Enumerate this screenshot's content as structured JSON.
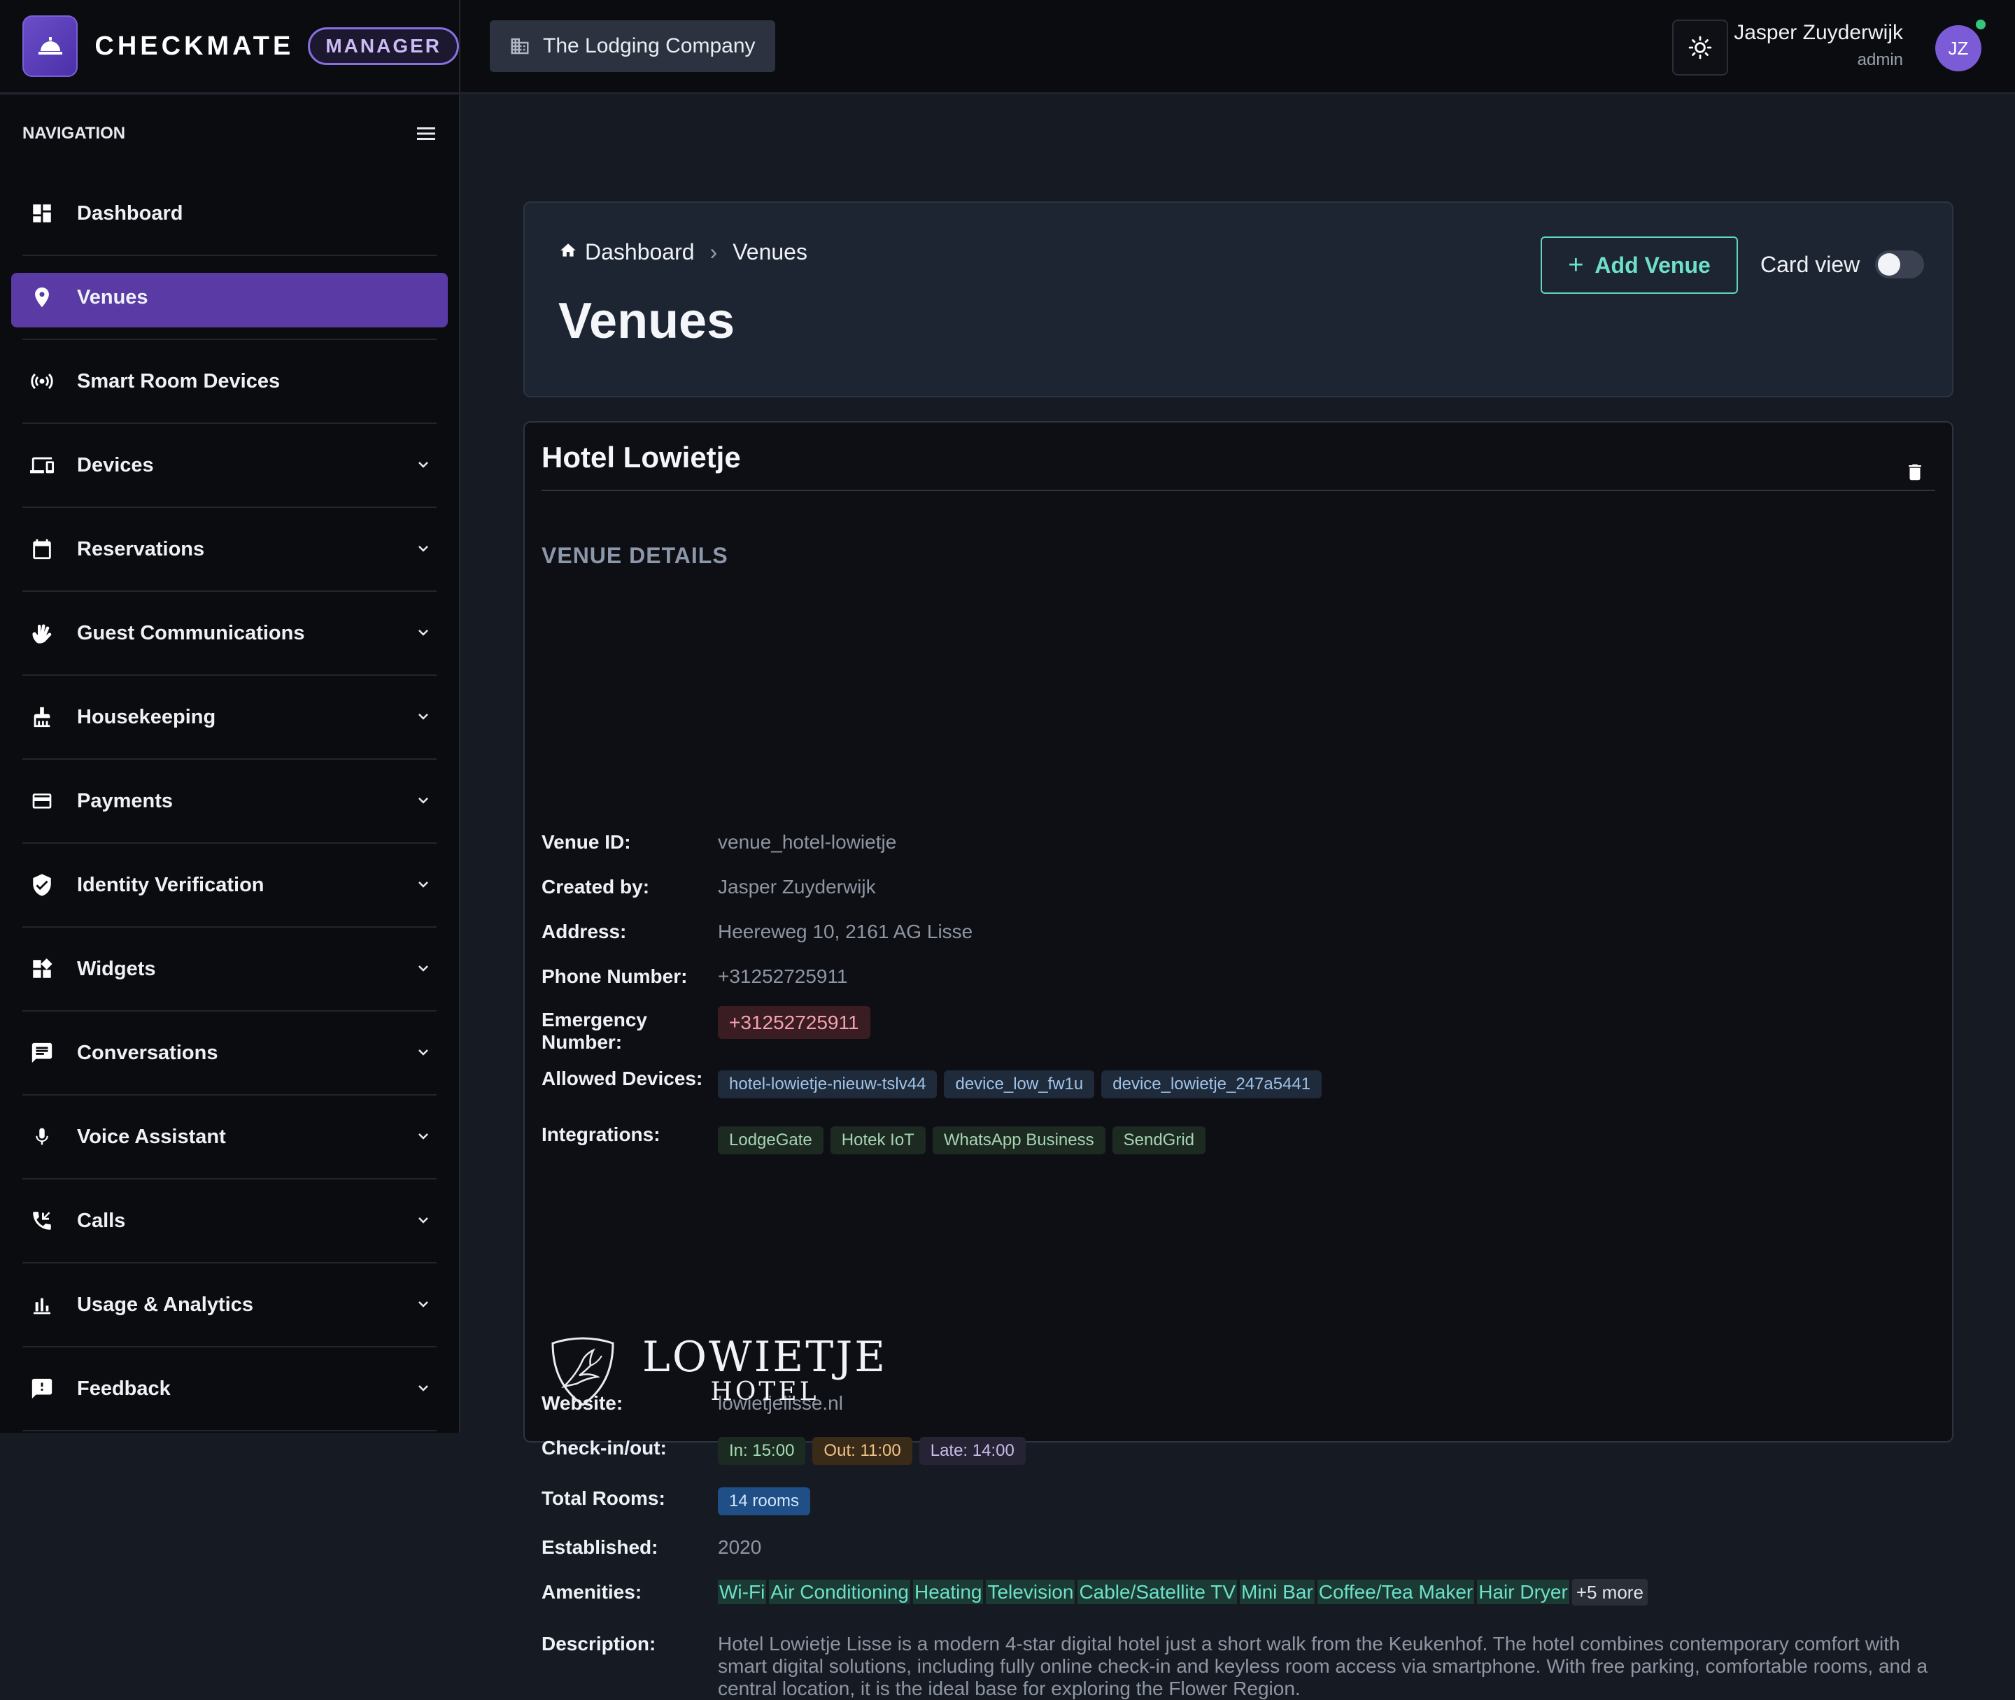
{
  "brand": {
    "name": "CHECKMATE",
    "badge": "MANAGER"
  },
  "company": {
    "name": "The Lodging Company"
  },
  "user": {
    "name": "Jasper Zuyderwijk",
    "role": "admin",
    "initials": "JZ"
  },
  "nav": {
    "title": "NAVIGATION",
    "items": [
      {
        "label": "Dashboard",
        "icon": "dashboard-icon"
      },
      {
        "label": "Venues",
        "icon": "location-pin-icon",
        "active": true
      },
      {
        "label": "Smart Room Devices",
        "icon": "broadcast-icon"
      },
      {
        "label": "Devices",
        "icon": "devices-icon"
      },
      {
        "label": "Reservations",
        "icon": "calendar-icon"
      },
      {
        "label": "Guest Communications",
        "icon": "waving-hand-icon"
      },
      {
        "label": "Housekeeping",
        "icon": "cleaning-icon"
      },
      {
        "label": "Payments",
        "icon": "credit-card-icon"
      },
      {
        "label": "Identity Verification",
        "icon": "verified-shield-icon"
      },
      {
        "label": "Widgets",
        "icon": "widgets-icon"
      },
      {
        "label": "Conversations",
        "icon": "chat-icon"
      },
      {
        "label": "Voice Assistant",
        "icon": "microphone-icon"
      },
      {
        "label": "Calls",
        "icon": "phone-icon"
      },
      {
        "label": "Usage & Analytics",
        "icon": "bar-chart-icon"
      },
      {
        "label": "Feedback",
        "icon": "feedback-icon"
      }
    ]
  },
  "header": {
    "breadcrumb_home": "Dashboard",
    "breadcrumb_sep": "›",
    "breadcrumb_current": "Venues",
    "title": "Venues",
    "add_button": "Add Venue",
    "add_plus": "+",
    "card_view": "Card view"
  },
  "venue": {
    "name": "Hotel Lowietje",
    "section": "VENUE DETAILS",
    "labels": {
      "id": "Venue ID:",
      "created": "Created by:",
      "address": "Address:",
      "phone": "Phone Number:",
      "emergency": "Emergency Number:",
      "devices": "Allowed Devices:",
      "integrations": "Integrations:",
      "website": "Website:",
      "checkin": "Check-in/out:",
      "rooms": "Total Rooms:",
      "established": "Established:",
      "amenities": "Amenities:",
      "description": "Description:"
    },
    "id": "venue_hotel-lowietje",
    "created_by": "Jasper Zuyderwijk",
    "address": "Heereweg 10, 2161 AG Lisse",
    "phone": "+31252725911",
    "emergency": "+31252725911",
    "devices": [
      "hotel-lowietje-nieuw-tslv44",
      "device_low_fw1u",
      "device_lowietje_247a5441"
    ],
    "integrations": [
      "LodgeGate",
      "Hotek IoT",
      "WhatsApp Business",
      "SendGrid"
    ],
    "website": "lowietjelisse.nl",
    "checkin": {
      "in": "In: 15:00",
      "out": "Out: 11:00",
      "late": "Late: 14:00"
    },
    "rooms": "14 rooms",
    "established": "2020",
    "amenities": [
      "Wi-Fi",
      "Air Conditioning",
      "Heating",
      "Television",
      "Cable/Satellite TV",
      "Mini Bar",
      "Coffee/Tea Maker",
      "Hair Dryer"
    ],
    "amenities_more": "+5 more",
    "description": "Hotel Lowietje Lisse is a modern 4-star digital hotel just a short walk from the Keukenhof. The hotel combines contemporary comfort with smart digital solutions, including fully online check-in and keyless room access via smartphone. With free parking, comfortable rooms, and a central location, it is the ideal base for exploring the Flower Region.",
    "logo": {
      "main": "LOWIETJE",
      "sub": "HOTEL"
    }
  }
}
